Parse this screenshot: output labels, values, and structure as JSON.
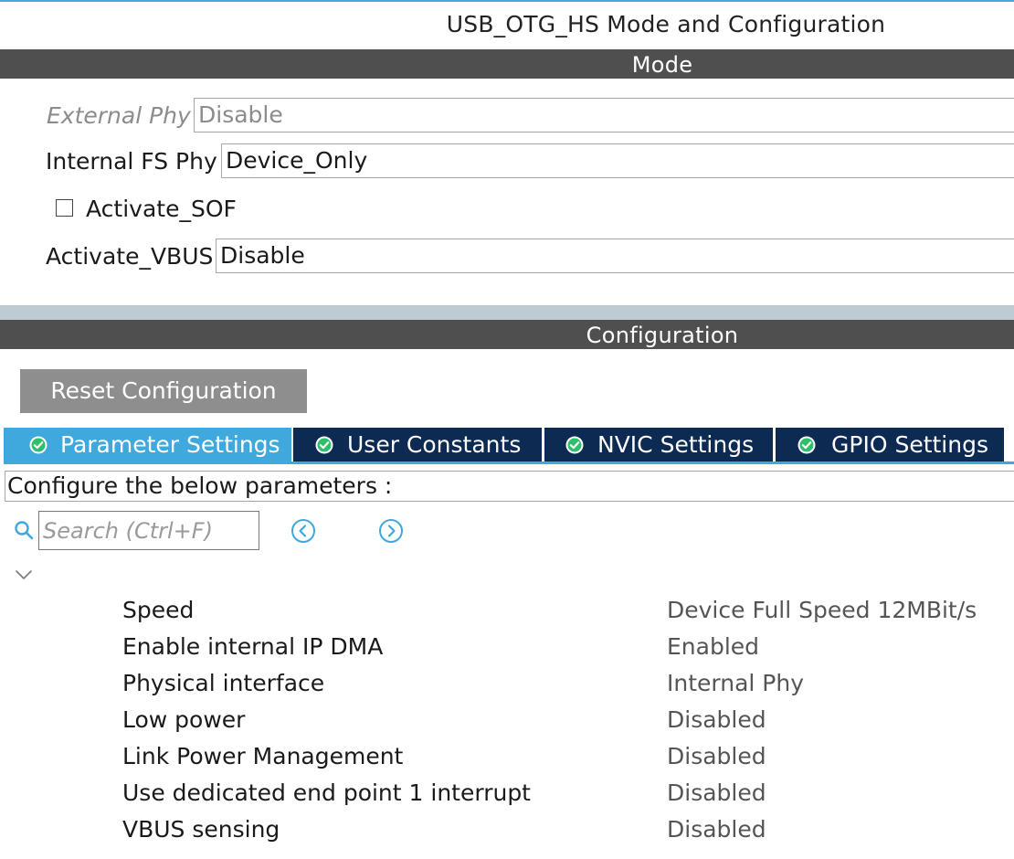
{
  "window": {
    "title": "USB_OTG_HS Mode and Configuration"
  },
  "mode": {
    "header": "Mode",
    "external_phy": {
      "label": "External Phy",
      "value": "Disable",
      "enabled": false
    },
    "internal_fs_phy": {
      "label": "Internal FS Phy",
      "value": "Device_Only"
    },
    "activate_sof": {
      "label": "Activate_SOF",
      "checked": false
    },
    "activate_vbus": {
      "label": "Activate_VBUS",
      "value": "Disable"
    }
  },
  "configuration": {
    "header": "Configuration",
    "reset_label": "Reset Configuration",
    "tabs": [
      {
        "label": "Parameter Settings",
        "active": true,
        "icon": "check-circle-icon"
      },
      {
        "label": "User Constants",
        "active": false,
        "icon": "check-circle-icon"
      },
      {
        "label": "NVIC Settings",
        "active": false,
        "icon": "check-circle-icon"
      },
      {
        "label": "GPIO Settings",
        "active": false,
        "icon": "check-circle-icon"
      }
    ],
    "instructions": "Configure the below parameters :",
    "search": {
      "placeholder": "Search (Ctrl+F)",
      "value": ""
    },
    "parameters": [
      {
        "name": "Speed",
        "value": "Device Full Speed 12MBit/s"
      },
      {
        "name": "Enable internal IP DMA",
        "value": "Enabled"
      },
      {
        "name": "Physical interface",
        "value": "Internal Phy"
      },
      {
        "name": "Low power",
        "value": "Disabled"
      },
      {
        "name": "Link Power Management",
        "value": "Disabled"
      },
      {
        "name": "Use dedicated end point 1 interrupt",
        "value": "Disabled"
      },
      {
        "name": "VBUS sensing",
        "value": "Disabled"
      }
    ]
  },
  "colors": {
    "section_bar": "#4f4f4f",
    "tab_active": "#3fa9dd",
    "tab_inactive": "#0c2a52",
    "reset_button": "#8e8e8e",
    "check_icon": "#2fbf6b",
    "nav_icon": "#3fa9dd"
  }
}
